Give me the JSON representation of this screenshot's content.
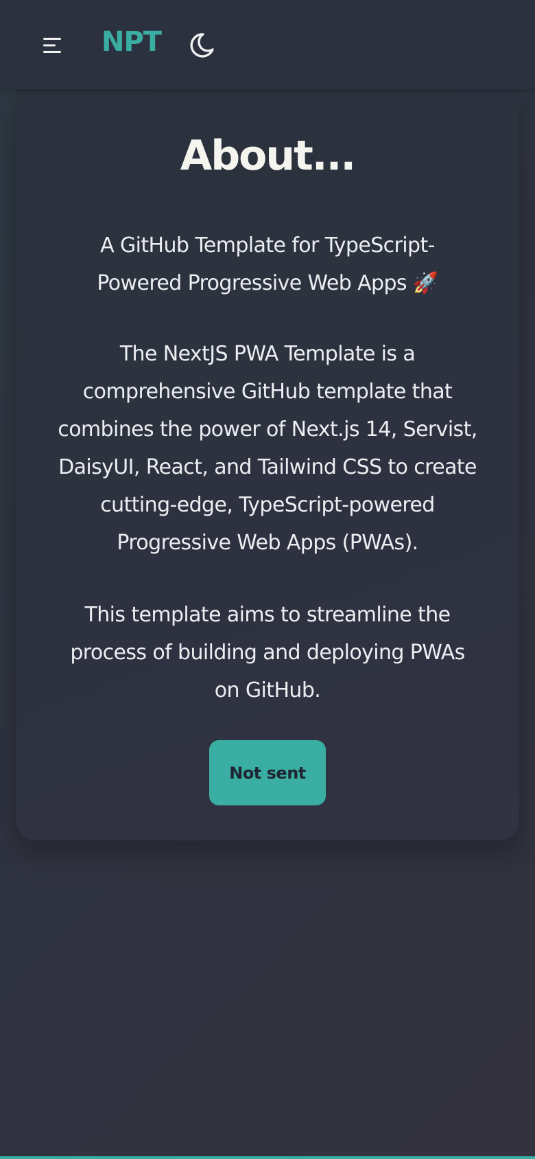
{
  "navbar": {
    "menu_icon": "menu-icon",
    "logo": "NPT",
    "theme_icon": "moon-icon"
  },
  "content": {
    "title": "About...",
    "subtitle_line1": "A GitHub Template for TypeScript-",
    "subtitle_line2": "Powered Progressive Web Apps 🚀",
    "description": "The NextJS PWA Template is a comprehensive GitHub template that combines the power of Next.js 14, Servist, DaisyUI, React, and Tailwind CSS to create cutting-edge, TypeScript-powered Progressive Web Apps (PWAs).",
    "aim": "This template aims to streamline the process of building and deploying PWAs on GitHub.",
    "button_label": "Not sent"
  },
  "colors": {
    "accent": "#3aaea2",
    "navbar_bg": "#2c3140",
    "card_bg": "#2e3240",
    "text": "#eceef1",
    "title": "#f5f5ef"
  }
}
